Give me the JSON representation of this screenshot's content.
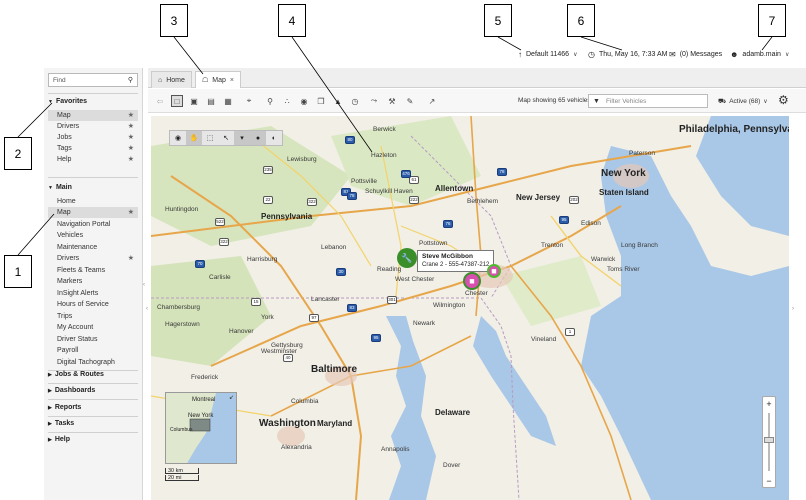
{
  "callouts": [
    "1",
    "2",
    "3",
    "4",
    "5",
    "6",
    "7"
  ],
  "topbar": {
    "group": "Default 11466",
    "datetime": "Thu, May 16, 7:33 AM",
    "messages": "(0) Messages",
    "user": "adamb.main"
  },
  "sidebar": {
    "search_placeholder": "Find",
    "favorites_title": "Favorites",
    "favorites": [
      "Map",
      "Drivers",
      "Jobs",
      "Tags",
      "Help"
    ],
    "main_title": "Main",
    "main_items": [
      "Home",
      "Map",
      "Navigation Portal",
      "Vehicles",
      "Maintenance",
      "Drivers",
      "Fleets & Teams",
      "Markers",
      "InSight Alerts",
      "Hours of Service",
      "Trips",
      "My Account",
      "Driver Status",
      "Payroll",
      "Digital Tachograph"
    ],
    "sections": [
      "Jobs & Routes",
      "Dashboards",
      "Reports",
      "Tasks",
      "Help"
    ]
  },
  "tabs": [
    {
      "label": "Home"
    },
    {
      "label": "Map"
    }
  ],
  "toolbar": {
    "map_count": "Map showing 65 vehicles",
    "filter_placeholder": "Filter Vehicles",
    "active": "Active (68)"
  },
  "map": {
    "states": [
      "Pennsylvania",
      "New Jersey",
      "Maryland",
      "Delaware"
    ],
    "big_cities": [
      "Philadelphia, Pennsylvania",
      "New York",
      "Baltimore",
      "Washington"
    ],
    "cities": [
      "Hazleton",
      "Berwick",
      "Lewisburg",
      "Pottsville",
      "Schuylkill Haven",
      "Allentown",
      "Bethlehem",
      "Reading",
      "Lancaster",
      "York",
      "Harrisburg",
      "Carlisle",
      "Chambersburg",
      "Hanover",
      "Westminster",
      "Frederick",
      "Hagerstown",
      "Columbia",
      "Annapolis",
      "Dover",
      "Wilmington",
      "Newark",
      "Trenton",
      "Edison",
      "Paterson",
      "Staten Island",
      "Toms River",
      "Vineland",
      "Alexandria",
      "Chester",
      "West Chester",
      "Hagerstown",
      "Gettysburg",
      "Huntingdon",
      "Lebanon",
      "Pottstown",
      "Warwick",
      "Long Branch"
    ],
    "vehicle_name": "Steve McGibbon",
    "vehicle_detail": "Crane 2 - 555-47387-212",
    "overview_city1": "Montreal",
    "overview_city2": "New York",
    "overview_city3": "Columbus",
    "scale_km": "30 km",
    "scale_mi": "20 mi"
  },
  "colors": {
    "marker_green": "#3a8f2a",
    "marker_pink": "#d94fb0",
    "water": "#a9c7e6",
    "land": "#f1efe6",
    "forest": "#cfe0b4"
  }
}
